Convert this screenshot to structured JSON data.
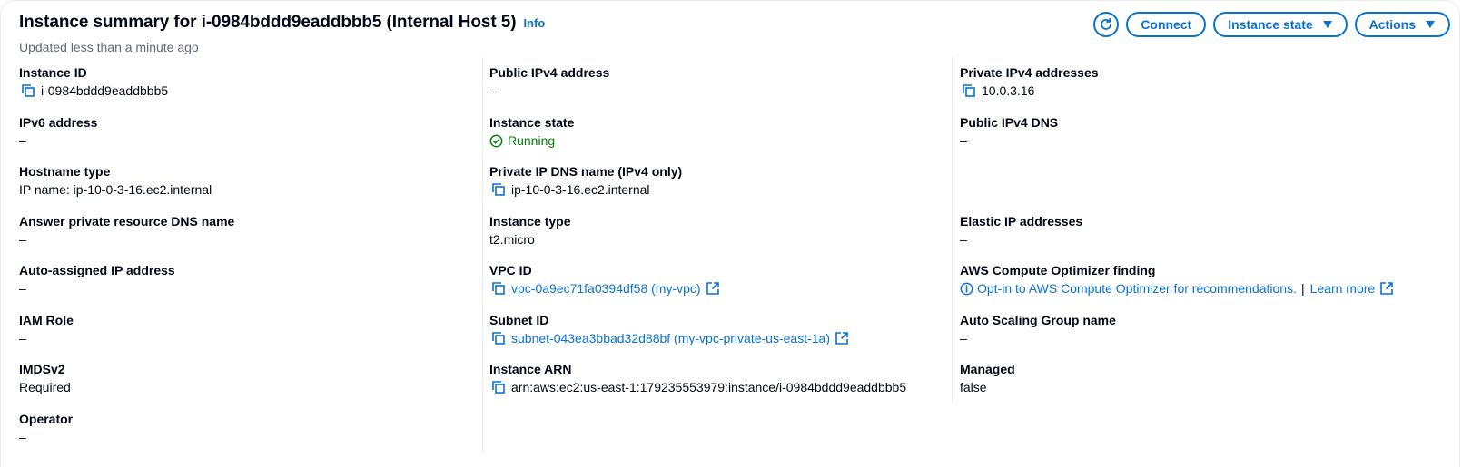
{
  "header": {
    "title": "Instance summary for i-0984bddd9eaddbbb5 (Internal Host 5)",
    "info_label": "Info",
    "subtitle": "Updated less than a minute ago"
  },
  "toolbar": {
    "refresh_icon": "refresh-icon",
    "connect_label": "Connect",
    "instance_state_label": "Instance state",
    "actions_label": "Actions"
  },
  "colors": {
    "link": "#0972d3",
    "success": "#037f0c",
    "text": "#000716",
    "muted": "#5f6b7a"
  },
  "column1": {
    "instance_id": {
      "label": "Instance ID",
      "value": "i-0984bddd9eaddbbb5"
    },
    "ipv6": {
      "label": "IPv6 address",
      "value": "–"
    },
    "hostname_type": {
      "label": "Hostname type",
      "value": "IP name: ip-10-0-3-16.ec2.internal"
    },
    "answer_dns": {
      "label": "Answer private resource DNS name",
      "value": "–"
    },
    "auto_ip": {
      "label": "Auto-assigned IP address",
      "value": "–"
    },
    "iam_role": {
      "label": "IAM Role",
      "value": "–"
    },
    "imdsv2": {
      "label": "IMDSv2",
      "value": "Required"
    },
    "operator": {
      "label": "Operator",
      "value": "–"
    }
  },
  "column2": {
    "public_ipv4": {
      "label": "Public IPv4 address",
      "value": "–"
    },
    "instance_state": {
      "label": "Instance state",
      "value": "Running"
    },
    "private_dns": {
      "label": "Private IP DNS name (IPv4 only)",
      "value": "ip-10-0-3-16.ec2.internal"
    },
    "instance_type": {
      "label": "Instance type",
      "value": "t2.micro"
    },
    "vpc_id": {
      "label": "VPC ID",
      "value": "vpc-0a9ec71fa0394df58 (my-vpc)"
    },
    "subnet_id": {
      "label": "Subnet ID",
      "value": "subnet-043ea3bbad32d88bf (my-vpc-private-us-east-1a)"
    },
    "instance_arn": {
      "label": "Instance ARN",
      "value": "arn:aws:ec2:us-east-1:179235553979:instance/i-0984bddd9eaddbbb5"
    }
  },
  "column3": {
    "private_ipv4": {
      "label": "Private IPv4 addresses",
      "value": "10.0.3.16"
    },
    "public_dns": {
      "label": "Public IPv4 DNS",
      "value": "–"
    },
    "elastic_ip": {
      "label": "Elastic IP addresses",
      "value": "–"
    },
    "optimizer": {
      "label": "AWS Compute Optimizer finding",
      "value": "Opt-in to AWS Compute Optimizer for recommendations.",
      "separator": "|",
      "learn_more": "Learn more"
    },
    "asg_name": {
      "label": "Auto Scaling Group name",
      "value": "–"
    },
    "managed": {
      "label": "Managed",
      "value": "false"
    }
  }
}
